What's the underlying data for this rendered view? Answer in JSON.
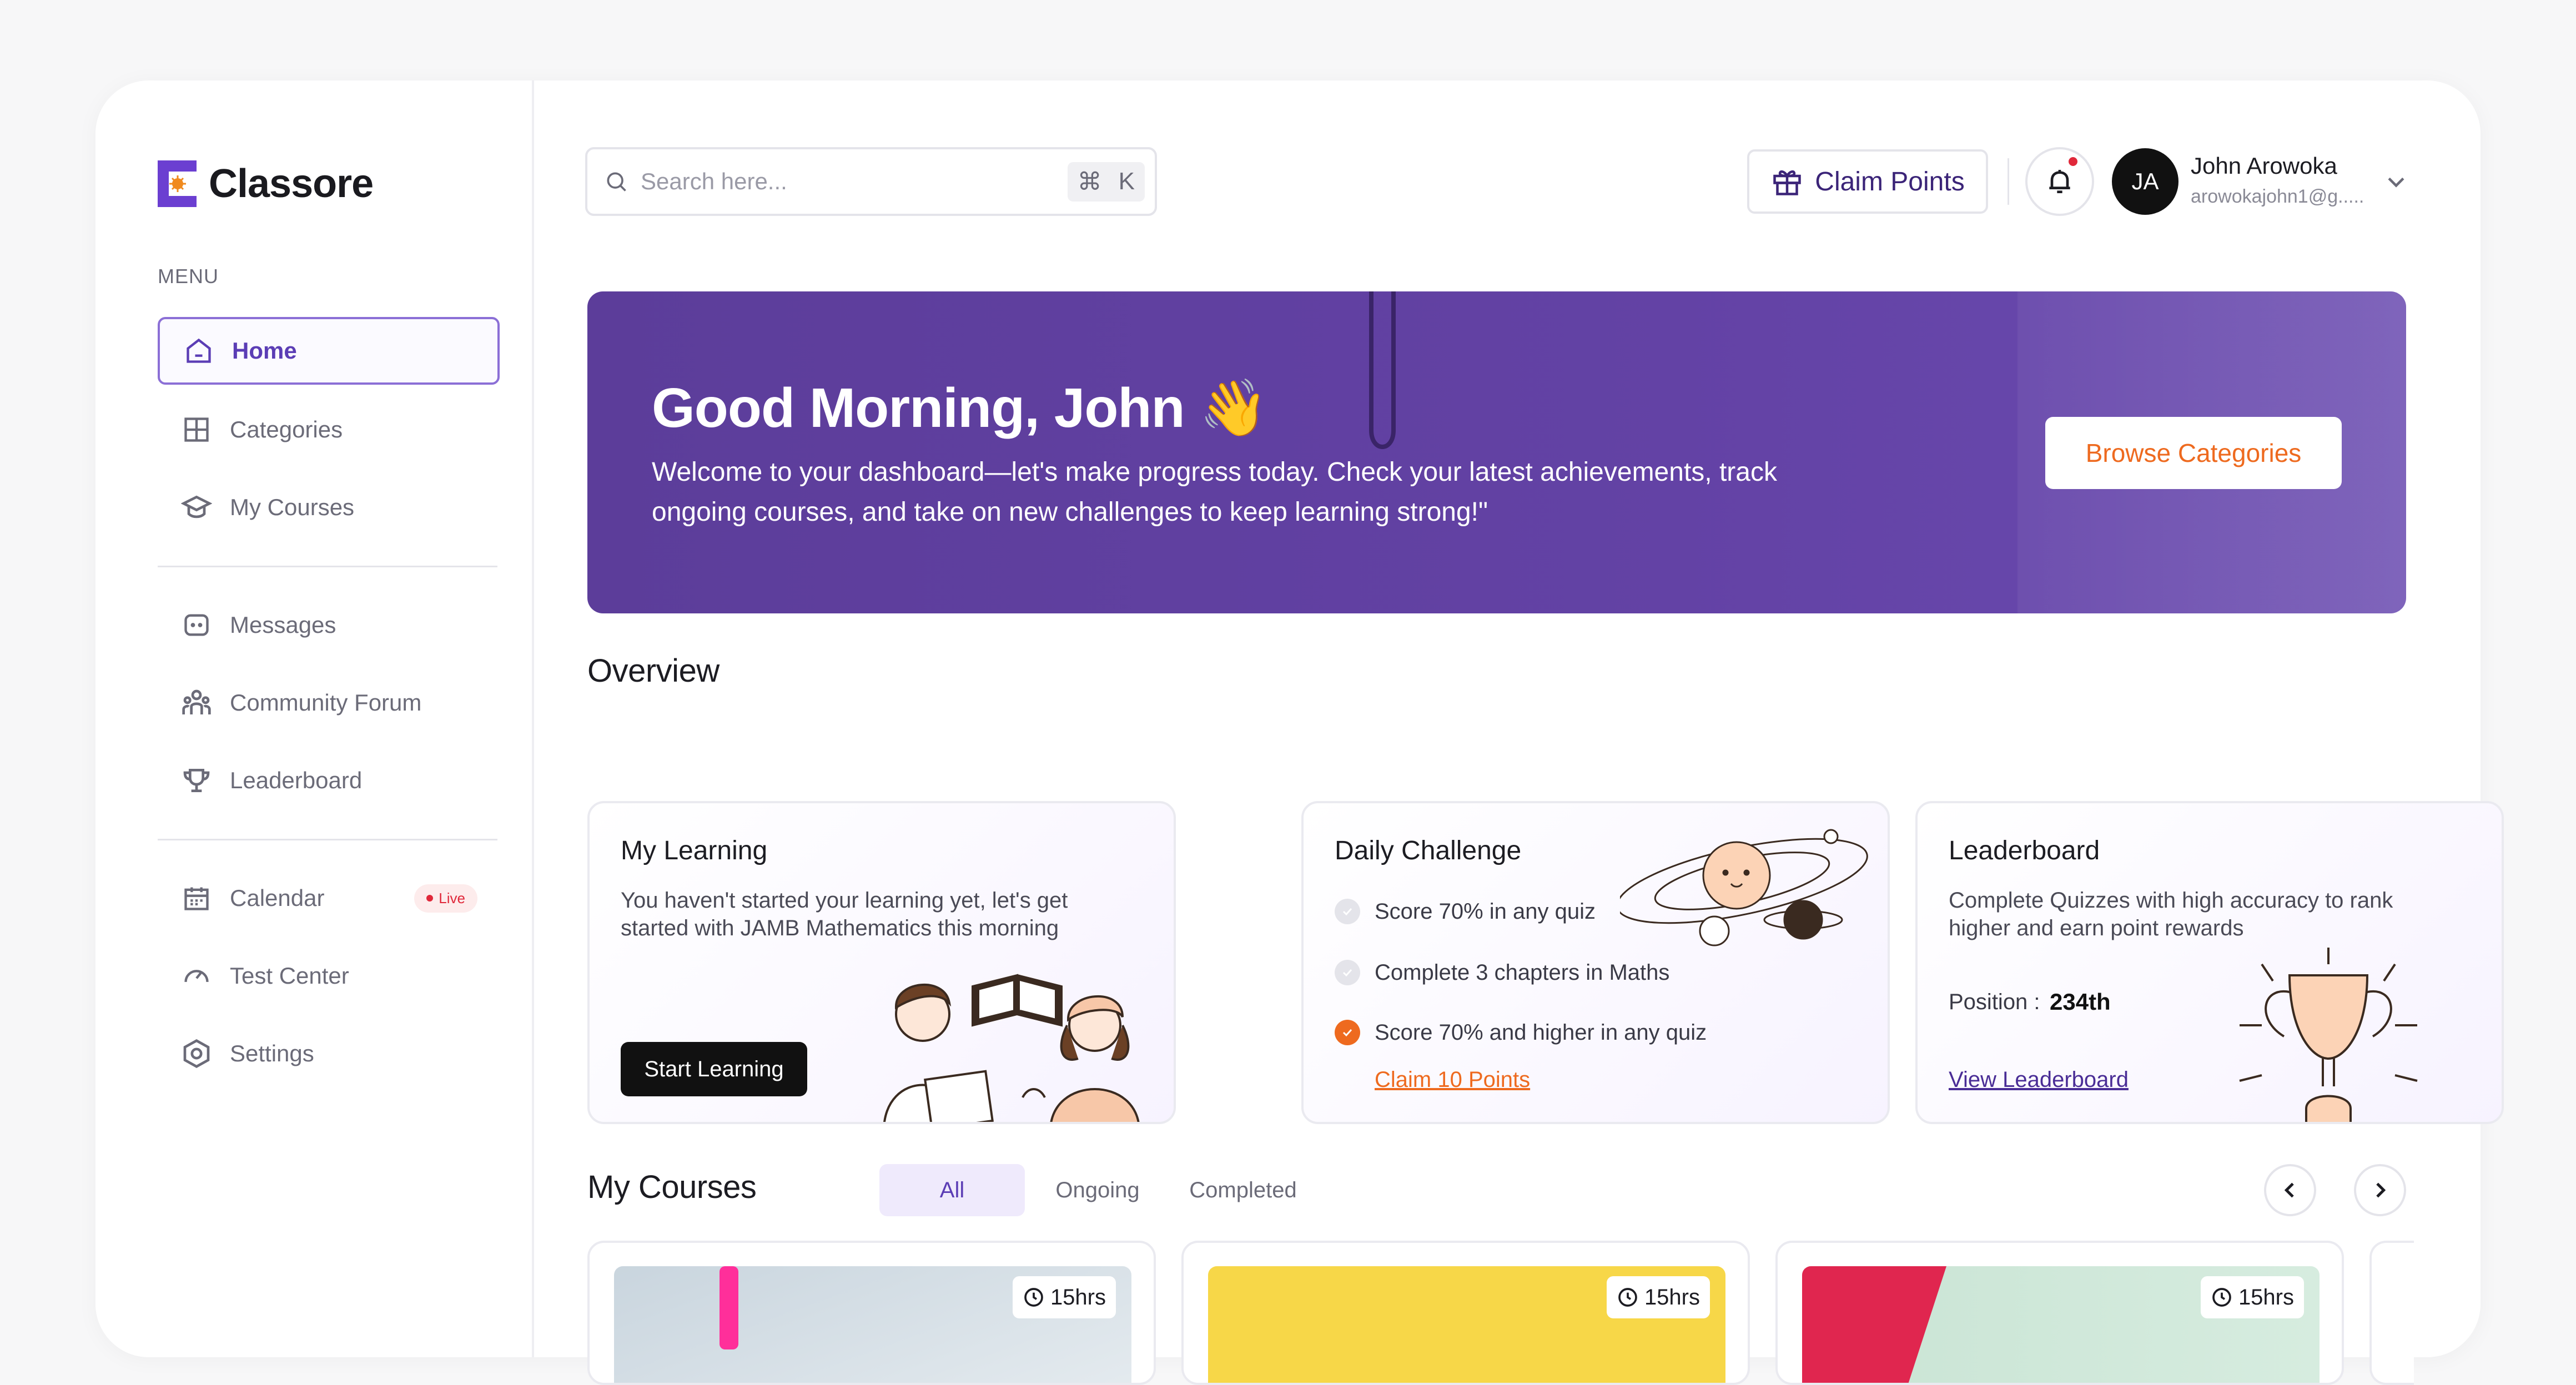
{
  "app": {
    "brand": "Classore",
    "menu_label": "MENU"
  },
  "sidebar": {
    "items": [
      {
        "label": "Home",
        "icon": "home-icon",
        "active": true
      },
      {
        "label": "Categories",
        "icon": "grid-icon"
      },
      {
        "label": "My Courses",
        "icon": "graduation-cap-icon"
      },
      {
        "label": "Messages",
        "icon": "chat-icon"
      },
      {
        "label": "Community Forum",
        "icon": "users-icon"
      },
      {
        "label": "Leaderboard",
        "icon": "trophy-icon"
      },
      {
        "label": "Calendar",
        "icon": "calendar-icon",
        "badge": "Live"
      },
      {
        "label": "Test Center",
        "icon": "gauge-icon"
      },
      {
        "label": "Settings",
        "icon": "settings-icon"
      }
    ]
  },
  "header": {
    "search_placeholder": "Search here...",
    "shortcut_cmd": "⌘",
    "shortcut_key": "K",
    "claim_label": "Claim Points",
    "user": {
      "initials": "JA",
      "name": "John Arowoka",
      "email": "arowokajohn1@g....."
    }
  },
  "hero": {
    "title": "Good Morning, John 👋",
    "text": "Welcome to your dashboard—let's make progress today. Check your latest achievements, track ongoing courses, and take on new challenges to keep learning strong!\"",
    "button": "Browse Categories"
  },
  "overview": {
    "title": "Overview",
    "learning": {
      "title": "My Learning",
      "text": "You haven't started your learning yet, let's get started with JAMB Mathematics this morning",
      "button": "Start Learning"
    },
    "challenge": {
      "title": "Daily Challenge",
      "tasks": [
        {
          "label": "Score 70% in any quiz",
          "done": false
        },
        {
          "label": "Complete 3 chapters in Maths",
          "done": false
        },
        {
          "label": "Score 70% and higher in any quiz",
          "done": true
        }
      ],
      "claim": "Claim 10 Points"
    },
    "leaderboard": {
      "title": "Leaderboard",
      "text": "Complete Quizzes with high accuracy to rank higher and earn point rewards",
      "position_label": "Position :",
      "position": "234th",
      "link": "View Leaderboard"
    }
  },
  "courses": {
    "title": "My Courses",
    "tabs": [
      "All",
      "Ongoing",
      "Completed"
    ],
    "items": [
      {
        "duration": "15hrs"
      },
      {
        "duration": "15hrs"
      },
      {
        "duration": "15hrs"
      }
    ]
  },
  "colors": {
    "accent": "#5b3db5",
    "orange": "#ee6a1f",
    "hero": "#6342a5"
  }
}
